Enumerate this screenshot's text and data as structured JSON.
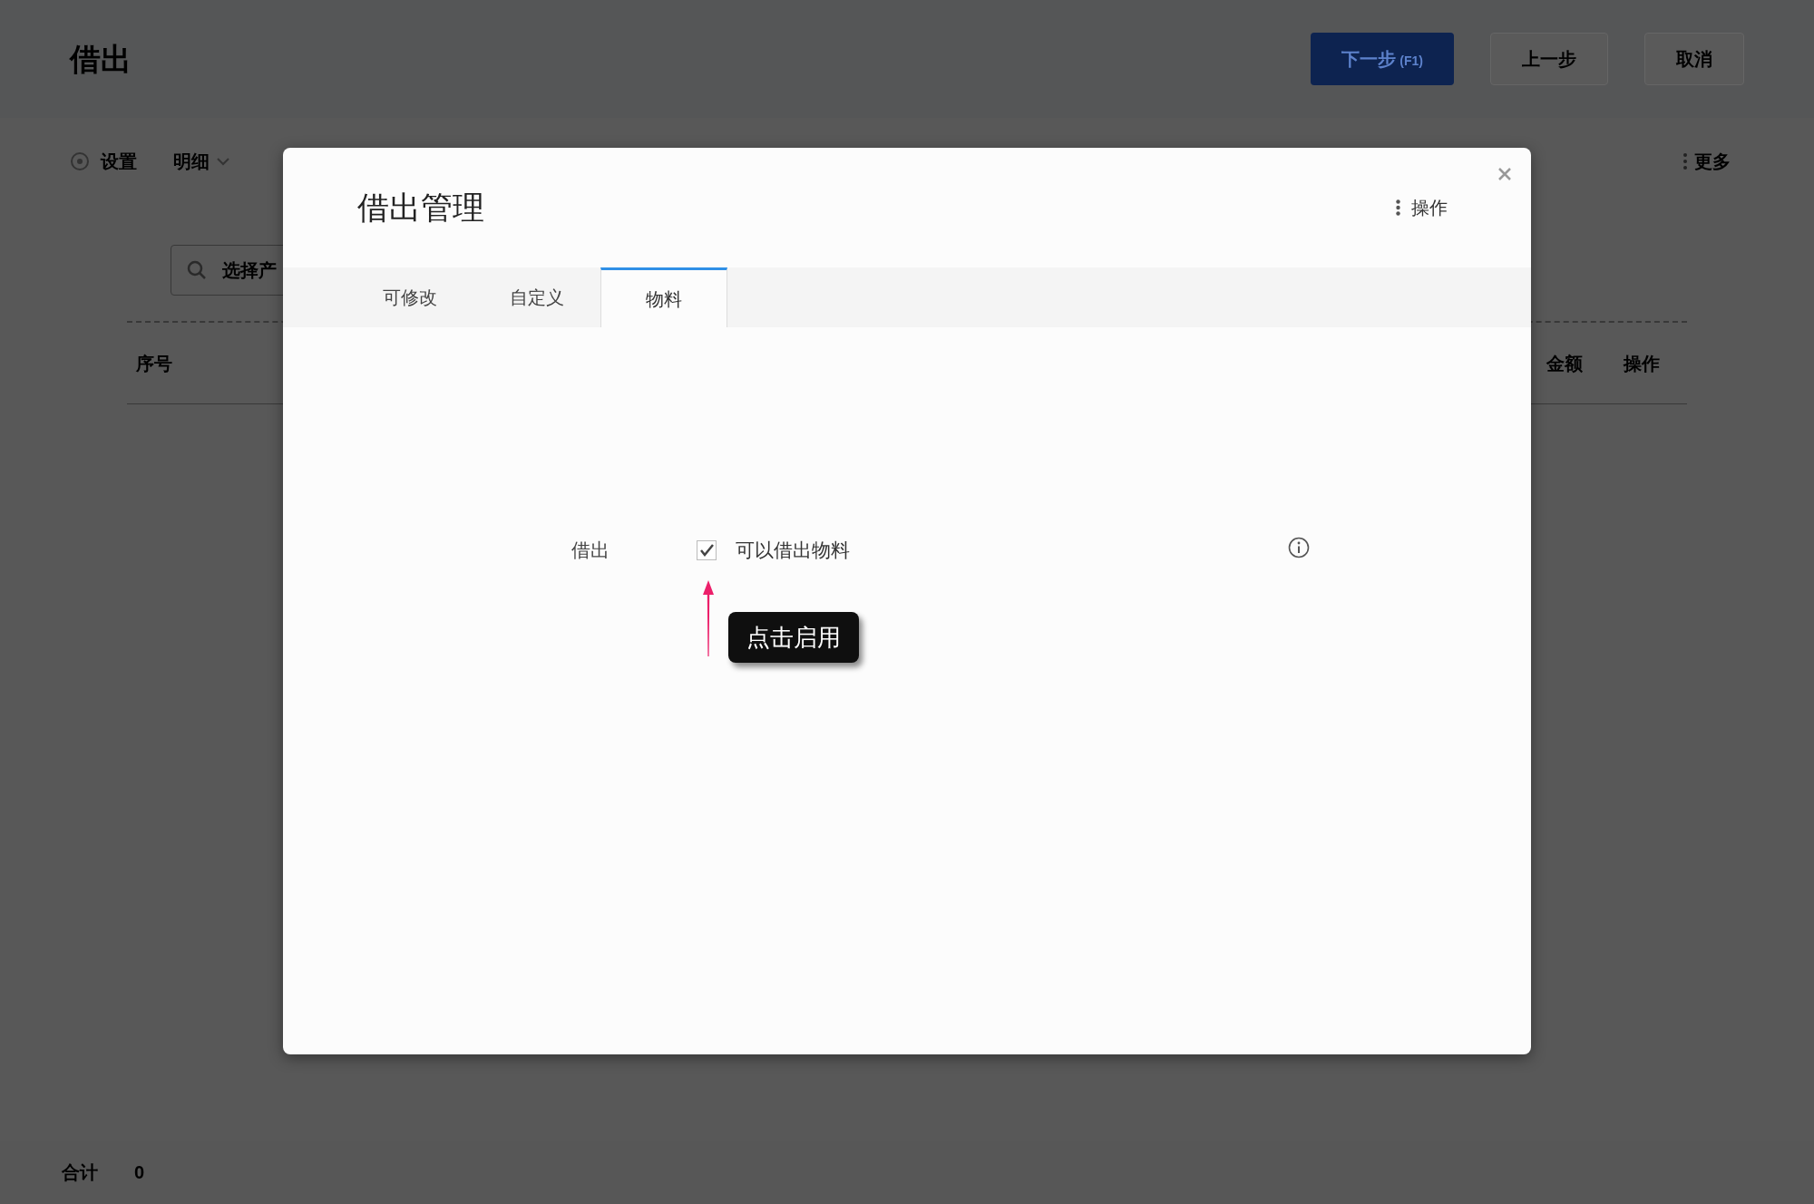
{
  "page": {
    "title": "借出",
    "buttons": [
      {
        "label": "下一步",
        "shortcut": "(F1)",
        "kind": "primary"
      },
      {
        "label": "上一步",
        "kind": "default"
      },
      {
        "label": "取消",
        "kind": "default"
      }
    ],
    "toolbar": {
      "settings": "设置",
      "view": "明细",
      "more": "更多"
    },
    "search": {
      "placeholder": "选择产"
    },
    "table": {
      "columns": [
        "序号",
        "金额",
        "操作"
      ]
    },
    "footer": {
      "label": "合计",
      "value": "0"
    }
  },
  "dialog": {
    "title": "借出管理",
    "action": "操作",
    "tabs": [
      {
        "label": "可修改",
        "selected": false
      },
      {
        "label": "自定义",
        "selected": false
      },
      {
        "label": "物料",
        "selected": true
      }
    ],
    "option": {
      "label": "借出",
      "text": "可以借出物料",
      "checked": true
    },
    "hint": "点击启用"
  }
}
